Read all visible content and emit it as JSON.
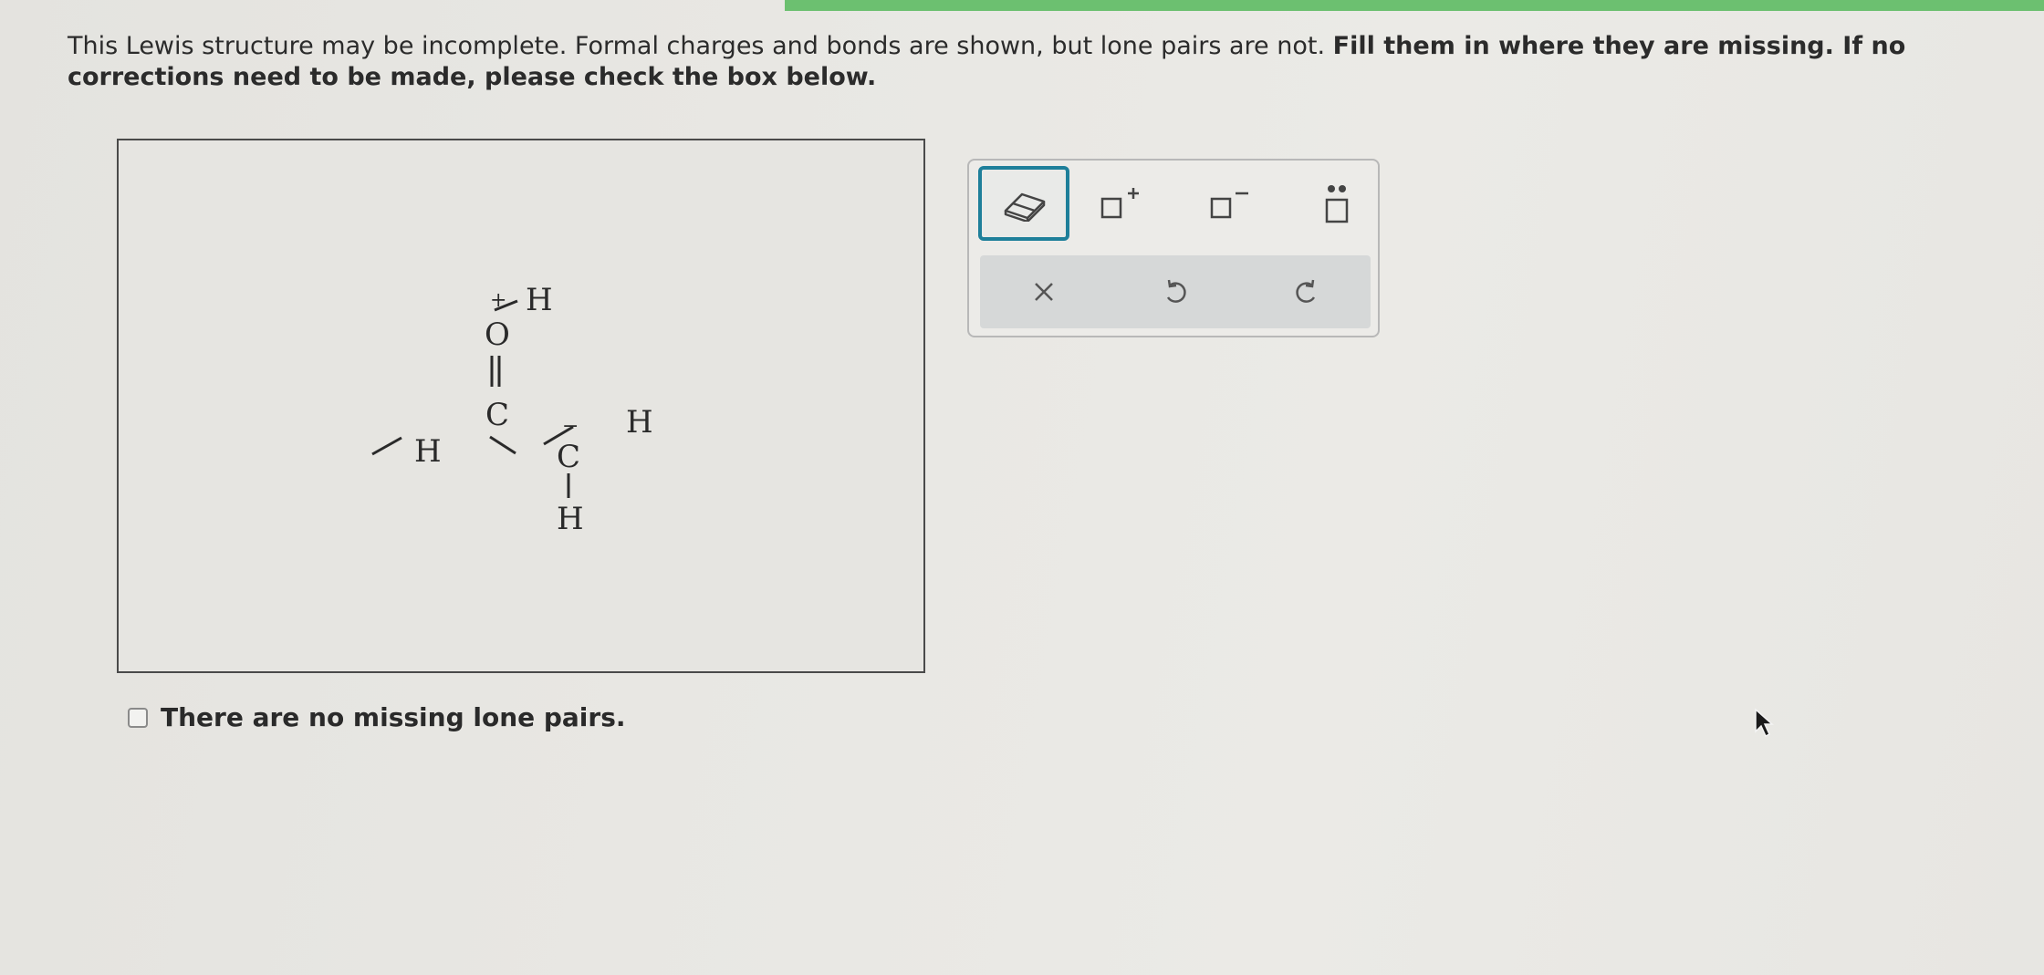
{
  "instructions": {
    "normal": "This Lewis structure may be incomplete. Formal charges and bonds are shown, but lone pairs are not. ",
    "bold": "Fill them in where they are missing. If no corrections need to be made, please check the box below."
  },
  "molecule": {
    "atoms": {
      "o_symbol": "O",
      "o_charge": "+",
      "h_on_o": "H",
      "c1_symbol": "C",
      "h_on_c1": "H",
      "c2_symbol": "C",
      "c2_charge": "−",
      "h_right": "H",
      "h_bottom": "H"
    }
  },
  "checkbox": {
    "label": "There are no missing lone pairs.",
    "checked": false
  },
  "toolbar": {
    "tools": [
      "eraser-icon",
      "positive-charge-icon",
      "negative-charge-icon",
      "lone-pair-icon"
    ],
    "selected_tool": "eraser-icon",
    "actions": [
      "clear-icon",
      "undo-icon",
      "redo-icon"
    ]
  },
  "colors": {
    "accent": "#1e7f9a",
    "progress": "#6cc070"
  }
}
